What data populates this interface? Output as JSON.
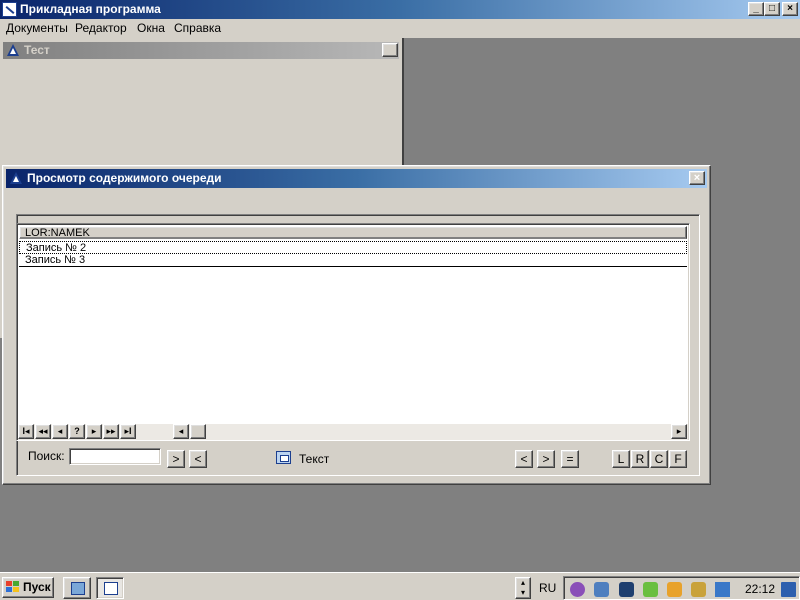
{
  "app": {
    "title": "Прикладная программа",
    "controls": {
      "minimize": "_",
      "maximize": "□",
      "close": "×"
    }
  },
  "menu": {
    "items": [
      "Документы",
      "Редактор",
      "Окна",
      "Справка"
    ]
  },
  "child_window": {
    "title": "Тест",
    "close": "×"
  },
  "queue_window": {
    "title": "Просмотр содержимого очереди",
    "close": "×",
    "grid": {
      "column": "LOR:NAMEK",
      "rows": [
        "Запись № 2",
        "Запись № 3"
      ]
    },
    "nav": {
      "first": "I◂",
      "prev_page": "◂◂",
      "prev": "◂",
      "query": "?",
      "next": "▸",
      "next_page": "▸▸",
      "last": "▸I",
      "scroll_left": "◂",
      "scroll_right": "▸"
    },
    "search": {
      "label": "Поиск:",
      "value": "",
      "next": ">",
      "prev": "<"
    },
    "text_label": "Текст",
    "buttons": {
      "left": "<",
      "right": ">",
      "equal": "=",
      "l": "L",
      "r": "R",
      "c": "C",
      "f": "F"
    }
  },
  "taskbar": {
    "start": "Пуск",
    "spin_up": "▴",
    "spin_down": "▾",
    "language": "RU",
    "clock": "22:12"
  },
  "colors": {
    "title_active": "#0a246a",
    "title_inactive": "#808080",
    "face": "#d4d0c8",
    "desktop": "#808080"
  }
}
